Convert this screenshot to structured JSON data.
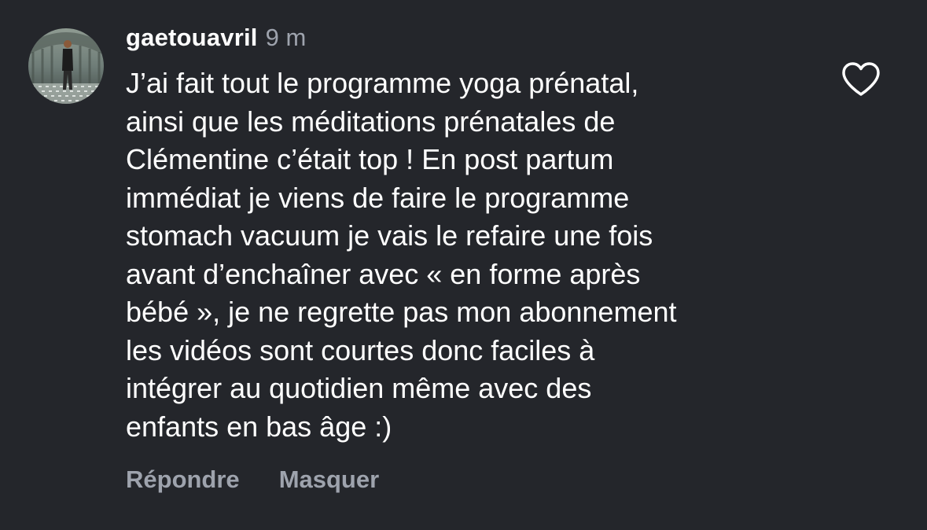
{
  "comment": {
    "username": "gaetouavril",
    "time": "9 m",
    "text": "J’ai fait tout le programme yoga prénatal,\nainsi que les méditations prénatales de\nClémentine c’était top ! En post partum\nimmédiat je viens de faire le programme\nstomach vacuum je vais le refaire une fois\navant d’enchaîner avec « en forme après\nbébé », je ne regrette pas mon abonnement\nles vidéos sont courtes donc faciles à\nintégrer au quotidien même avec des\nenfants en bas âge :)",
    "like_icon": "heart-outline-icon"
  },
  "actions": {
    "reply_label": "Répondre",
    "hide_label": "Masquer"
  },
  "colors": {
    "background": "#24262b",
    "text": "#ffffff",
    "muted": "#9ea3ad"
  }
}
